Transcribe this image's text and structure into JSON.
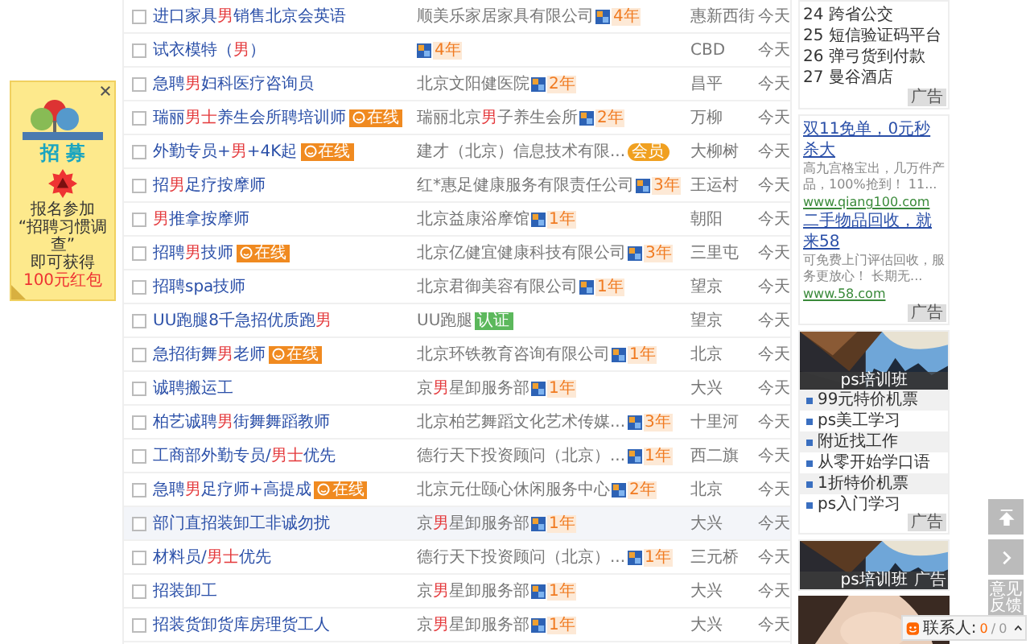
{
  "jobs": [
    {
      "title": [
        {
          "text": "进口家具",
          "highlight": false
        },
        {
          "text": "男",
          "highlight": true
        },
        {
          "text": "销售北京会英语",
          "highlight": false
        }
      ],
      "checked": false,
      "hovered": false,
      "company": [
        {
          "text": "顺美乐家居家具有限公司",
          "highlight": false
        }
      ],
      "badge": {
        "kind": "years",
        "text": "4年"
      },
      "location": "惠新西街",
      "date": "今天"
    },
    {
      "title": [
        {
          "text": "试衣模特（",
          "highlight": false
        },
        {
          "text": "男",
          "highlight": true
        },
        {
          "text": "）",
          "highlight": false
        }
      ],
      "checked": false,
      "hovered": false,
      "badge": {
        "kind": "years",
        "text": "4年"
      },
      "location": "CBD",
      "date": "今天"
    },
    {
      "title": [
        {
          "text": "急聘",
          "highlight": false
        },
        {
          "text": "男",
          "highlight": true
        },
        {
          "text": "妇科医疗咨询员",
          "highlight": false
        }
      ],
      "checked": false,
      "hovered": false,
      "company": [
        {
          "text": "北京文阳健医院",
          "highlight": false
        }
      ],
      "badge": {
        "kind": "years",
        "text": "2年"
      },
      "location": "昌平",
      "date": "今天"
    },
    {
      "title": [
        {
          "text": "瑞丽",
          "highlight": false
        },
        {
          "text": "男士",
          "highlight": true
        },
        {
          "text": "养生会所聘培训师",
          "highlight": false
        }
      ],
      "tag": "在线",
      "checked": false,
      "hovered": false,
      "company": [
        {
          "text": "瑞丽北京",
          "highlight": false
        },
        {
          "text": "男",
          "highlight": true
        },
        {
          "text": "子养生会所",
          "highlight": false
        }
      ],
      "badge": {
        "kind": "years",
        "text": "2年"
      },
      "location": "万柳",
      "date": "今天"
    },
    {
      "title": [
        {
          "text": "外勤专员+",
          "highlight": false
        },
        {
          "text": "男",
          "highlight": true
        },
        {
          "text": "+4K起",
          "highlight": false
        }
      ],
      "tag": "在线",
      "checked": false,
      "hovered": false,
      "company": [
        {
          "text": "建才（北京）信息技术有限...",
          "highlight": false
        }
      ],
      "badge": {
        "kind": "vip",
        "text": "会员"
      },
      "location": "大柳树",
      "date": "今天"
    },
    {
      "title": [
        {
          "text": "招",
          "highlight": false
        },
        {
          "text": "男",
          "highlight": true
        },
        {
          "text": "足疗按摩师",
          "highlight": false
        }
      ],
      "checked": false,
      "hovered": false,
      "company": [
        {
          "text": "红*惠足健康服务有限责任公司",
          "highlight": false
        }
      ],
      "badge": {
        "kind": "years",
        "text": "3年"
      },
      "location": "王运村",
      "date": "今天"
    },
    {
      "title": [
        {
          "text": "男",
          "highlight": true
        },
        {
          "text": "推拿按摩师",
          "highlight": false
        }
      ],
      "checked": false,
      "hovered": false,
      "company": [
        {
          "text": "北京益康浴摩馆",
          "highlight": false
        }
      ],
      "badge": {
        "kind": "years",
        "text": "1年"
      },
      "location": "朝阳",
      "date": "今天"
    },
    {
      "title": [
        {
          "text": "招聘",
          "highlight": false
        },
        {
          "text": "男",
          "highlight": true
        },
        {
          "text": "技师",
          "highlight": false
        }
      ],
      "tag": "在线",
      "checked": false,
      "hovered": false,
      "company": [
        {
          "text": "北京亿健宜健康科技有限公司",
          "highlight": false
        }
      ],
      "badge": {
        "kind": "years",
        "text": "3年"
      },
      "location": "三里屯",
      "date": "今天"
    },
    {
      "title": [
        {
          "text": "招聘spa技师",
          "highlight": false
        }
      ],
      "checked": false,
      "hovered": false,
      "company": [
        {
          "text": "北京君御美容有限公司",
          "highlight": false
        }
      ],
      "badge": {
        "kind": "years",
        "text": "1年"
      },
      "location": "望京",
      "date": "今天"
    },
    {
      "title": [
        {
          "text": "UU跑腿8千急招优质跑",
          "highlight": false
        },
        {
          "text": "男",
          "highlight": true
        }
      ],
      "checked": false,
      "hovered": false,
      "company": [
        {
          "text": "UU跑腿",
          "highlight": false
        }
      ],
      "badge": {
        "kind": "verified",
        "text": "认证"
      },
      "location": "望京",
      "date": "今天"
    },
    {
      "title": [
        {
          "text": "急招街舞",
          "highlight": false
        },
        {
          "text": "男",
          "highlight": true
        },
        {
          "text": "老师",
          "highlight": false
        }
      ],
      "tag": "在线",
      "checked": false,
      "hovered": false,
      "company": [
        {
          "text": "北京环铁教育咨询有限公司",
          "highlight": false
        }
      ],
      "badge": {
        "kind": "years",
        "text": "1年"
      },
      "location": "北京",
      "date": "今天"
    },
    {
      "title": [
        {
          "text": "诚聘搬运工",
          "highlight": false
        }
      ],
      "checked": false,
      "hovered": false,
      "company": [
        {
          "text": "京",
          "highlight": false
        },
        {
          "text": "男",
          "highlight": true
        },
        {
          "text": "星卸服务部",
          "highlight": false
        }
      ],
      "badge": {
        "kind": "years",
        "text": "1年"
      },
      "location": "大兴",
      "date": "今天"
    },
    {
      "title": [
        {
          "text": "柏艺诚聘",
          "highlight": false
        },
        {
          "text": "男",
          "highlight": true
        },
        {
          "text": "街舞舞蹈教师",
          "highlight": false
        }
      ],
      "checked": false,
      "hovered": false,
      "company": [
        {
          "text": "北京柏艺舞蹈文化艺术传媒...",
          "highlight": false
        }
      ],
      "badge": {
        "kind": "years",
        "text": "3年"
      },
      "location": "十里河",
      "date": "今天"
    },
    {
      "title": [
        {
          "text": "工商部外勤专员/",
          "highlight": false
        },
        {
          "text": "男士",
          "highlight": true
        },
        {
          "text": "优先",
          "highlight": false
        }
      ],
      "checked": false,
      "hovered": false,
      "company": [
        {
          "text": "德行天下投资顾问（北京）...",
          "highlight": false
        }
      ],
      "badge": {
        "kind": "years",
        "text": "1年"
      },
      "location": "西二旗",
      "date": "今天"
    },
    {
      "title": [
        {
          "text": "急聘",
          "highlight": false
        },
        {
          "text": "男",
          "highlight": true
        },
        {
          "text": "足疗师+高提成",
          "highlight": false
        }
      ],
      "tag": "在线",
      "checked": false,
      "hovered": false,
      "company": [
        {
          "text": "北京元仕颐心休闲服务中心",
          "highlight": false
        }
      ],
      "badge": {
        "kind": "years",
        "text": "2年"
      },
      "location": "北京",
      "date": "今天"
    },
    {
      "title": [
        {
          "text": "部门直招装卸工非诚勿扰",
          "highlight": false
        }
      ],
      "checked": false,
      "hovered": true,
      "company": [
        {
          "text": "京",
          "highlight": false
        },
        {
          "text": "男",
          "highlight": true
        },
        {
          "text": "星卸服务部",
          "highlight": false
        }
      ],
      "badge": {
        "kind": "years",
        "text": "1年"
      },
      "location": "大兴",
      "date": "今天"
    },
    {
      "title": [
        {
          "text": "材料员/",
          "highlight": false
        },
        {
          "text": "男士",
          "highlight": true
        },
        {
          "text": "优先",
          "highlight": false
        }
      ],
      "checked": false,
      "hovered": false,
      "company": [
        {
          "text": "德行天下投资顾问（北京）...",
          "highlight": false
        }
      ],
      "badge": {
        "kind": "years",
        "text": "1年"
      },
      "location": "三元桥",
      "date": "今天"
    },
    {
      "title": [
        {
          "text": "招装卸工",
          "highlight": false
        }
      ],
      "checked": false,
      "hovered": false,
      "company": [
        {
          "text": "京",
          "highlight": false
        },
        {
          "text": "男",
          "highlight": true
        },
        {
          "text": "星卸服务部",
          "highlight": false
        }
      ],
      "badge": {
        "kind": "years",
        "text": "1年"
      },
      "location": "大兴",
      "date": "今天"
    },
    {
      "title": [
        {
          "text": "招装货卸货库房理货工人",
          "highlight": false
        }
      ],
      "checked": false,
      "hovered": false,
      "company": [
        {
          "text": "京",
          "highlight": false
        },
        {
          "text": "男",
          "highlight": true
        },
        {
          "text": "星卸服务部",
          "highlight": false
        }
      ],
      "badge": {
        "kind": "years",
        "text": "1年"
      },
      "location": "大兴",
      "date": "今天"
    }
  ],
  "sidebar": {
    "ranking": [
      {
        "rank": "24",
        "text": "跨省公交"
      },
      {
        "rank": "25",
        "text": "短信验证码平台"
      },
      {
        "rank": "26",
        "text": "弹弓货到付款"
      },
      {
        "rank": "27",
        "text": "曼谷酒店"
      }
    ],
    "ranking_tag": "广告",
    "text_ads": [
      {
        "link": "双11免单，0元秒杀大",
        "description": "高九宫格宝出，几万件产品，100%抢到！ 11...",
        "url": "www.qiang100.com"
      },
      {
        "link": "二手物品回收，就来58",
        "description": "可免费上门评估回收，服务更放心！ 长期无...",
        "url": "www.58.com"
      }
    ],
    "text_ads_tag": "广告",
    "image_ad": {
      "caption": "ps培训班",
      "items": [
        "99元特价机票",
        "ps美工学习",
        "附近找工作",
        "从零开始学口语",
        "1折特价机票",
        "ps入门学习"
      ],
      "tag": "广告"
    },
    "image_ad_2": {
      "caption": "ps培训班",
      "tag": "广告"
    }
  },
  "float_ad": {
    "heading": "招 募",
    "lines": [
      "报名参加",
      "“招聘习惯调查”",
      "即可获得"
    ],
    "reward": "100元红包"
  },
  "side_buttons": {
    "feedback": "意见反馈"
  },
  "contact_bar": {
    "label": "联系人:",
    "count": "0",
    "separator": "/",
    "total": "0"
  }
}
